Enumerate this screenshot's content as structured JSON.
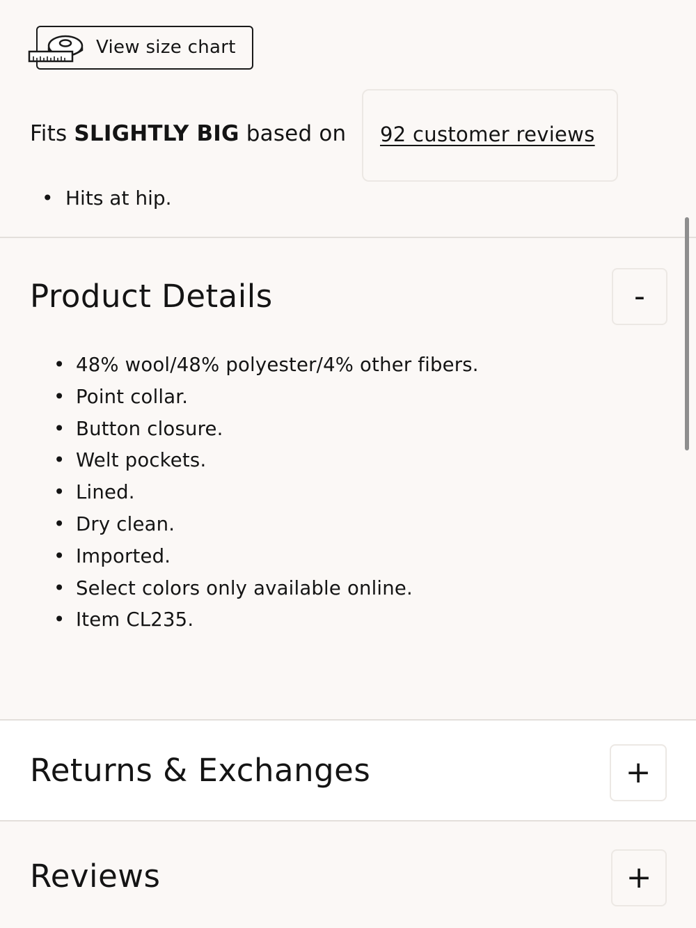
{
  "size_chart": {
    "icon": "measuring-tape-icon",
    "label": "View size chart"
  },
  "fit": {
    "prefix": "Fits ",
    "emphasis": "SLIGHTLY BIG",
    "suffix": " based on",
    "reviews_link": "92 customer reviews",
    "bullets": [
      "Hits at hip."
    ]
  },
  "product_details": {
    "title": "Product Details",
    "toggle": "-",
    "items": [
      "48% wool/48% polyester/4% other fibers.",
      "Point collar.",
      "Button closure.",
      "Welt pockets.",
      "Lined.",
      "Dry clean.",
      "Imported.",
      "Select colors only available online.",
      "Item CL235."
    ]
  },
  "returns": {
    "title": "Returns & Exchanges",
    "toggle": "+"
  },
  "reviews": {
    "title": "Reviews",
    "toggle": "+"
  }
}
